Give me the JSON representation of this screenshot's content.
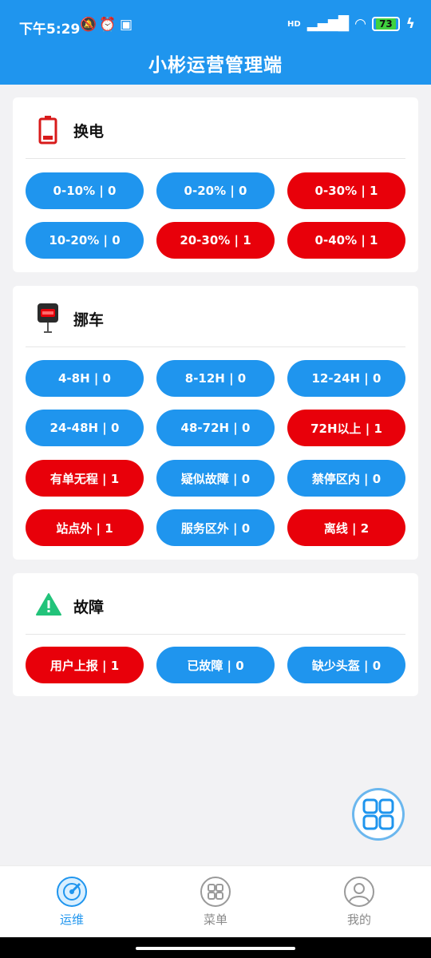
{
  "status": {
    "time": "下午5:29",
    "network": "HD",
    "battery": "73"
  },
  "header": {
    "title": "小彬运营管理端"
  },
  "sections": [
    {
      "title": "换电",
      "icon": "battery-low-icon",
      "buttons": [
        {
          "label": "0-10% | 0",
          "color": "blue"
        },
        {
          "label": "0-20% | 0",
          "color": "blue"
        },
        {
          "label": "0-30% | 1",
          "color": "red"
        },
        {
          "label": "10-20% | 0",
          "color": "blue"
        },
        {
          "label": "20-30% | 1",
          "color": "red"
        },
        {
          "label": "0-40% | 1",
          "color": "red"
        }
      ]
    },
    {
      "title": "挪车",
      "icon": "parking-sign-icon",
      "buttons": [
        {
          "label": "4-8H | 0",
          "color": "blue"
        },
        {
          "label": "8-12H | 0",
          "color": "blue"
        },
        {
          "label": "12-24H | 0",
          "color": "blue"
        },
        {
          "label": "24-48H | 0",
          "color": "blue"
        },
        {
          "label": "48-72H | 0",
          "color": "blue"
        },
        {
          "label": "72H以上 | 1",
          "color": "red"
        },
        {
          "label": "有单无程 | 1",
          "color": "red"
        },
        {
          "label": "疑似故障 | 0",
          "color": "blue"
        },
        {
          "label": "禁停区内 | 0",
          "color": "blue"
        },
        {
          "label": "站点外 | 1",
          "color": "red"
        },
        {
          "label": "服务区外 | 0",
          "color": "blue"
        },
        {
          "label": "离线 | 2",
          "color": "red"
        }
      ]
    },
    {
      "title": "故障",
      "icon": "warning-icon",
      "buttons": [
        {
          "label": "用户上报 | 1",
          "color": "red"
        },
        {
          "label": "已故障 | 0",
          "color": "blue"
        },
        {
          "label": "缺少头盔 | 0",
          "color": "blue"
        }
      ]
    }
  ],
  "nav": [
    {
      "label": "运维",
      "icon": "ops-radar-icon",
      "active": true
    },
    {
      "label": "菜单",
      "icon": "grid-menu-icon",
      "active": false
    },
    {
      "label": "我的",
      "icon": "profile-icon",
      "active": false
    }
  ],
  "colors": {
    "primary": "#1f95ee",
    "alert": "#e8000a",
    "nav_inactive": "#8a8a8a"
  }
}
